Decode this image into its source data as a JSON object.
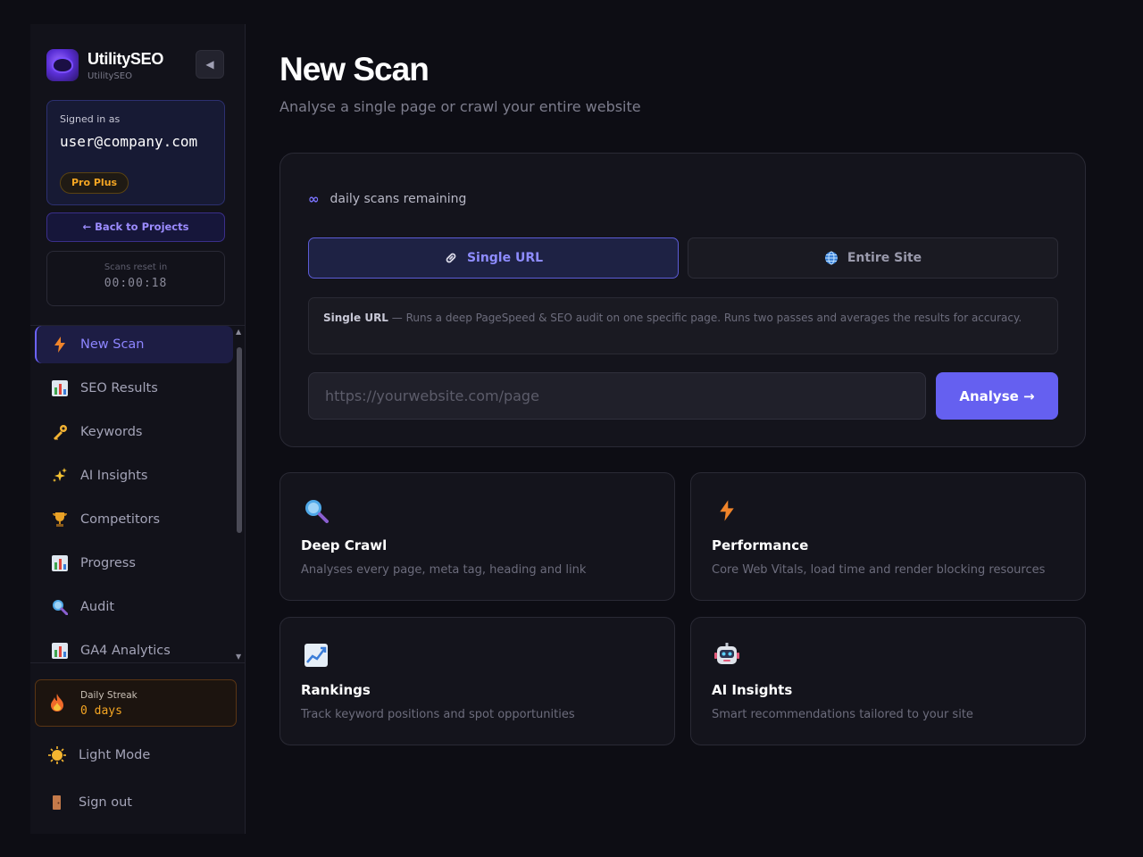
{
  "sidebar": {
    "brand_name": "UtilitySEO",
    "brand_sub": "UtilitySEO",
    "collapse_icon": "◀",
    "signed_in_label": "Signed in as",
    "user_email": "user@company.com",
    "plan": "Pro Plus",
    "back_label": "← Back to Projects",
    "reset_label": "Scans reset in",
    "reset_time": "00:00:18",
    "nav": [
      {
        "label": "New Scan",
        "icon": "lightning-icon",
        "active": true
      },
      {
        "label": "SEO Results",
        "icon": "bar-chart-icon"
      },
      {
        "label": "Keywords",
        "icon": "key-icon"
      },
      {
        "label": "AI Insights",
        "icon": "sparkles-icon"
      },
      {
        "label": "Competitors",
        "icon": "trophy-icon"
      },
      {
        "label": "Progress",
        "icon": "bar-chart-icon"
      },
      {
        "label": "Audit",
        "icon": "magnifier-icon"
      },
      {
        "label": "GA4 Analytics",
        "icon": "bar-chart-icon"
      }
    ],
    "streak_label": "Daily Streak",
    "streak_value": "0 days",
    "light_mode_label": "Light Mode",
    "sign_out_label": "Sign out"
  },
  "main": {
    "title": "New Scan",
    "subtitle": "Analyse a single page or crawl your entire website",
    "remaining_icon": "∞",
    "remaining_text": "daily scans remaining",
    "mode_single": "Single URL",
    "mode_site": "Entire Site",
    "mode_desc_title": "Single URL",
    "mode_desc_text": " — Runs a deep PageSpeed & SEO audit on one specific page. Runs two passes and averages the results for accuracy.",
    "url_placeholder": "https://yourwebsite.com/page",
    "url_value": "",
    "analyse_label": "Analyse →",
    "features": [
      {
        "title": "Deep Crawl",
        "desc": "Analyses every page, meta tag, heading and link",
        "icon": "magnifier-icon"
      },
      {
        "title": "Performance",
        "desc": "Core Web Vitals, load time and render blocking resources",
        "icon": "lightning-icon"
      },
      {
        "title": "Rankings",
        "desc": "Track keyword positions and spot opportunities",
        "icon": "trend-chart-icon"
      },
      {
        "title": "AI Insights",
        "desc": "Smart recommendations tailored to your site",
        "icon": "robot-icon"
      }
    ]
  },
  "colors": {
    "accent": "#6560f0",
    "active_text": "#8d85ff",
    "plan": "#f5a623",
    "background": "#0d0d14"
  }
}
